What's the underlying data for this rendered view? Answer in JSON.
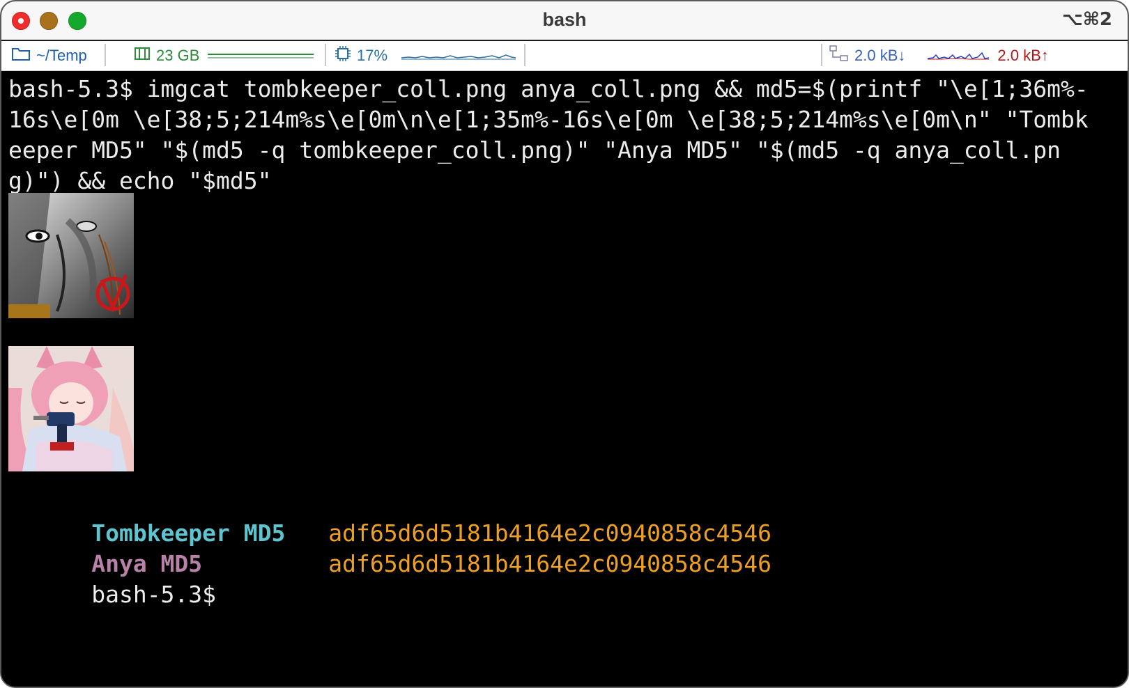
{
  "window": {
    "title": "bash",
    "shortcut": "⌥⌘2"
  },
  "statusbar": {
    "path": "~/Temp",
    "disk": "23 GB",
    "cpu": "17%",
    "net_down": "2.0 kB↓",
    "net_up": "2.0 kB↑",
    "colors": {
      "path": "#1f5fb0",
      "disk": "#2e8b3a",
      "cpu": "#2a6fa0",
      "net_down": "#3a64b5",
      "net_up": "#b01a1a"
    }
  },
  "terminal": {
    "command_line": "bash-5.3$ imgcat tombkeeper_coll.png anya_coll.png && md5=$(printf \"\\e[1;36m%-16s\\e[0m \\e[38;5;214m%s\\e[0m\\n\\e[1;35m%-16s\\e[0m \\e[38;5;214m%s\\e[0m\\n\" \"Tombkeeper MD5\" \"$(md5 -q tombkeeper_coll.png)\" \"Anya MD5\" \"$(md5 -q anya_coll.png)\") && echo \"$md5\"",
    "images": [
      {
        "name": "tombkeeper-image"
      },
      {
        "name": "anya-image"
      }
    ],
    "output": [
      {
        "label": "Tombkeeper MD5",
        "hash": "adf65d6d5181b4164e2c0940858c4546",
        "label_color": "#5ec4cf"
      },
      {
        "label": "Anya MD5",
        "hash": "adf65d6d5181b4164e2c0940858c4546",
        "label_color": "#b882a8"
      }
    ],
    "hash_color": "#f0a020",
    "prompt": "bash-5.3$"
  }
}
